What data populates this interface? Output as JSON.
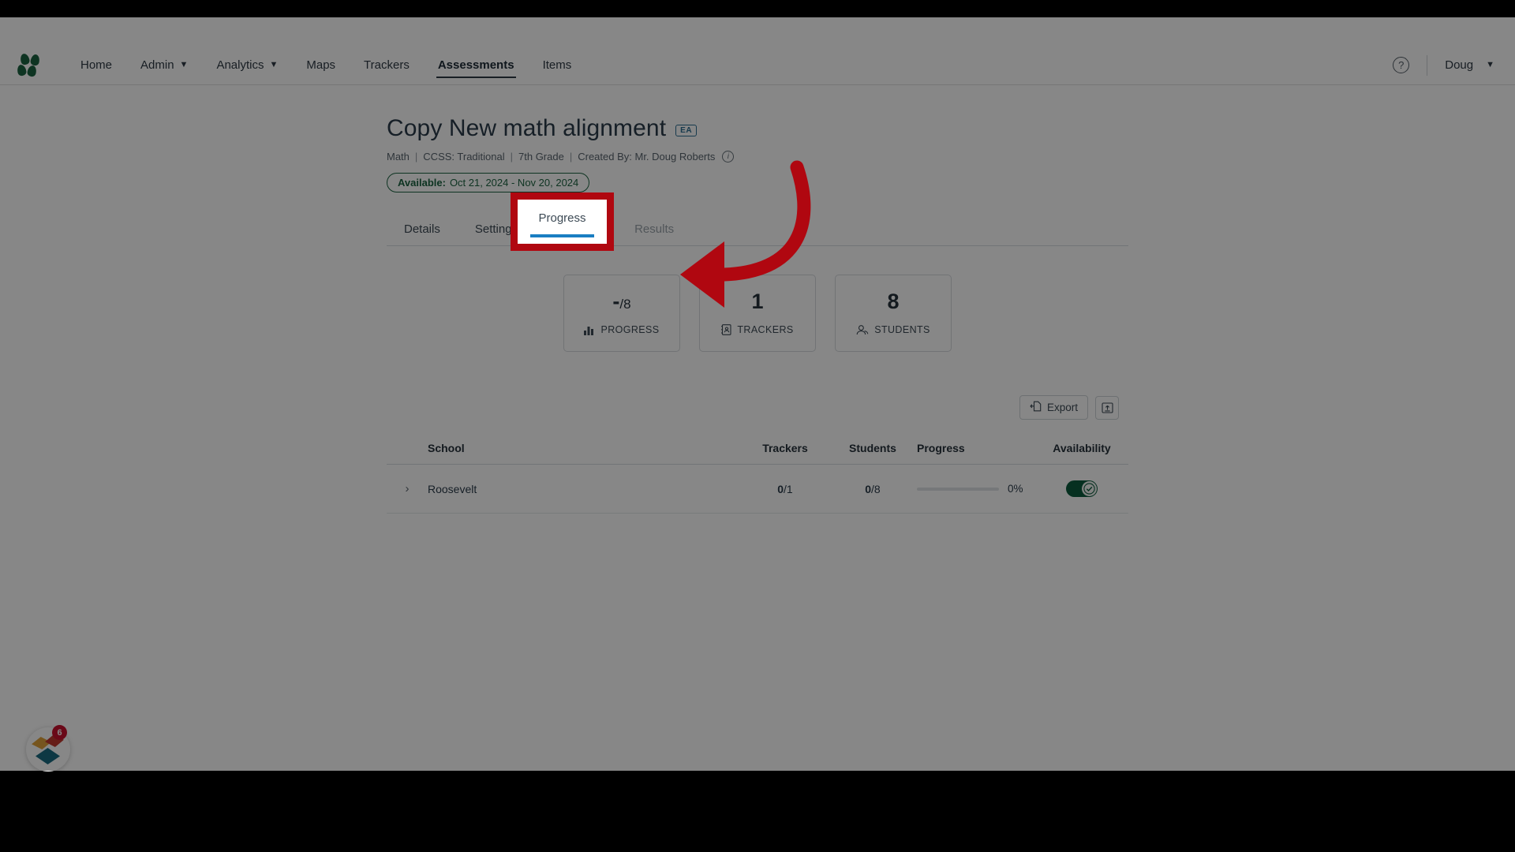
{
  "topnav": {
    "logo_name": "app-logo",
    "items": [
      {
        "label": "Home",
        "caret": false,
        "active": false
      },
      {
        "label": "Admin",
        "caret": true,
        "active": false
      },
      {
        "label": "Analytics",
        "caret": true,
        "active": false
      },
      {
        "label": "Maps",
        "caret": false,
        "active": false
      },
      {
        "label": "Trackers",
        "caret": false,
        "active": false
      },
      {
        "label": "Assessments",
        "caret": false,
        "active": true
      },
      {
        "label": "Items",
        "caret": false,
        "active": false
      }
    ],
    "help_icon": "help-circle-icon",
    "help_glyph": "?",
    "user_name": "Doug",
    "user_caret": "⌄"
  },
  "header": {
    "title": "Copy New math alignment",
    "badge": "EA",
    "meta": {
      "subject": "Math",
      "standard": "CCSS: Traditional",
      "grade": "7th Grade",
      "creator": "Created By: Mr. Doug Roberts",
      "separator": "|",
      "info_glyph": "i"
    },
    "availability": {
      "label": "Available:",
      "range": "Oct 21, 2024 - Nov 20, 2024"
    }
  },
  "tabs": [
    {
      "label": "Details",
      "state": "normal"
    },
    {
      "label": "Settings",
      "state": "normal"
    },
    {
      "label": "Progress",
      "state": "active"
    },
    {
      "label": "Results",
      "state": "disabled"
    }
  ],
  "stats": [
    {
      "value": "-",
      "suffix": "/8",
      "label": "PROGRESS",
      "icon": "bar-chart-icon"
    },
    {
      "value": "1",
      "suffix": "",
      "label": "TRACKERS",
      "icon": "tracker-book-icon"
    },
    {
      "value": "8",
      "suffix": "",
      "label": "STUDENTS",
      "icon": "students-icon"
    }
  ],
  "toolbar": {
    "export_label": "Export",
    "export_icon": "export-icon",
    "upload_icon": "upload-box-icon"
  },
  "table": {
    "columns": [
      "School",
      "Trackers",
      "Students",
      "Progress",
      "Availability"
    ],
    "rows": [
      {
        "expand_icon": "chevron-right-icon",
        "expand_glyph": "›",
        "school": "Roosevelt",
        "trackers_done": "0",
        "trackers_total": "/1",
        "students_done": "0",
        "students_total": "/8",
        "progress_pct": "0%",
        "progress_value": 0,
        "availability_on": true
      }
    ]
  },
  "fab": {
    "name": "help-widget",
    "badge_count": "6"
  },
  "annotation": {
    "highlight_tab_label": "Progress",
    "arrow_color": "#b00710",
    "box_color": "#b00710"
  },
  "colors": {
    "accent_blue": "#1a7ec2",
    "brand_green": "#1c6340",
    "toggle_green": "#0c5c3d",
    "annotation_red": "#b00710"
  }
}
